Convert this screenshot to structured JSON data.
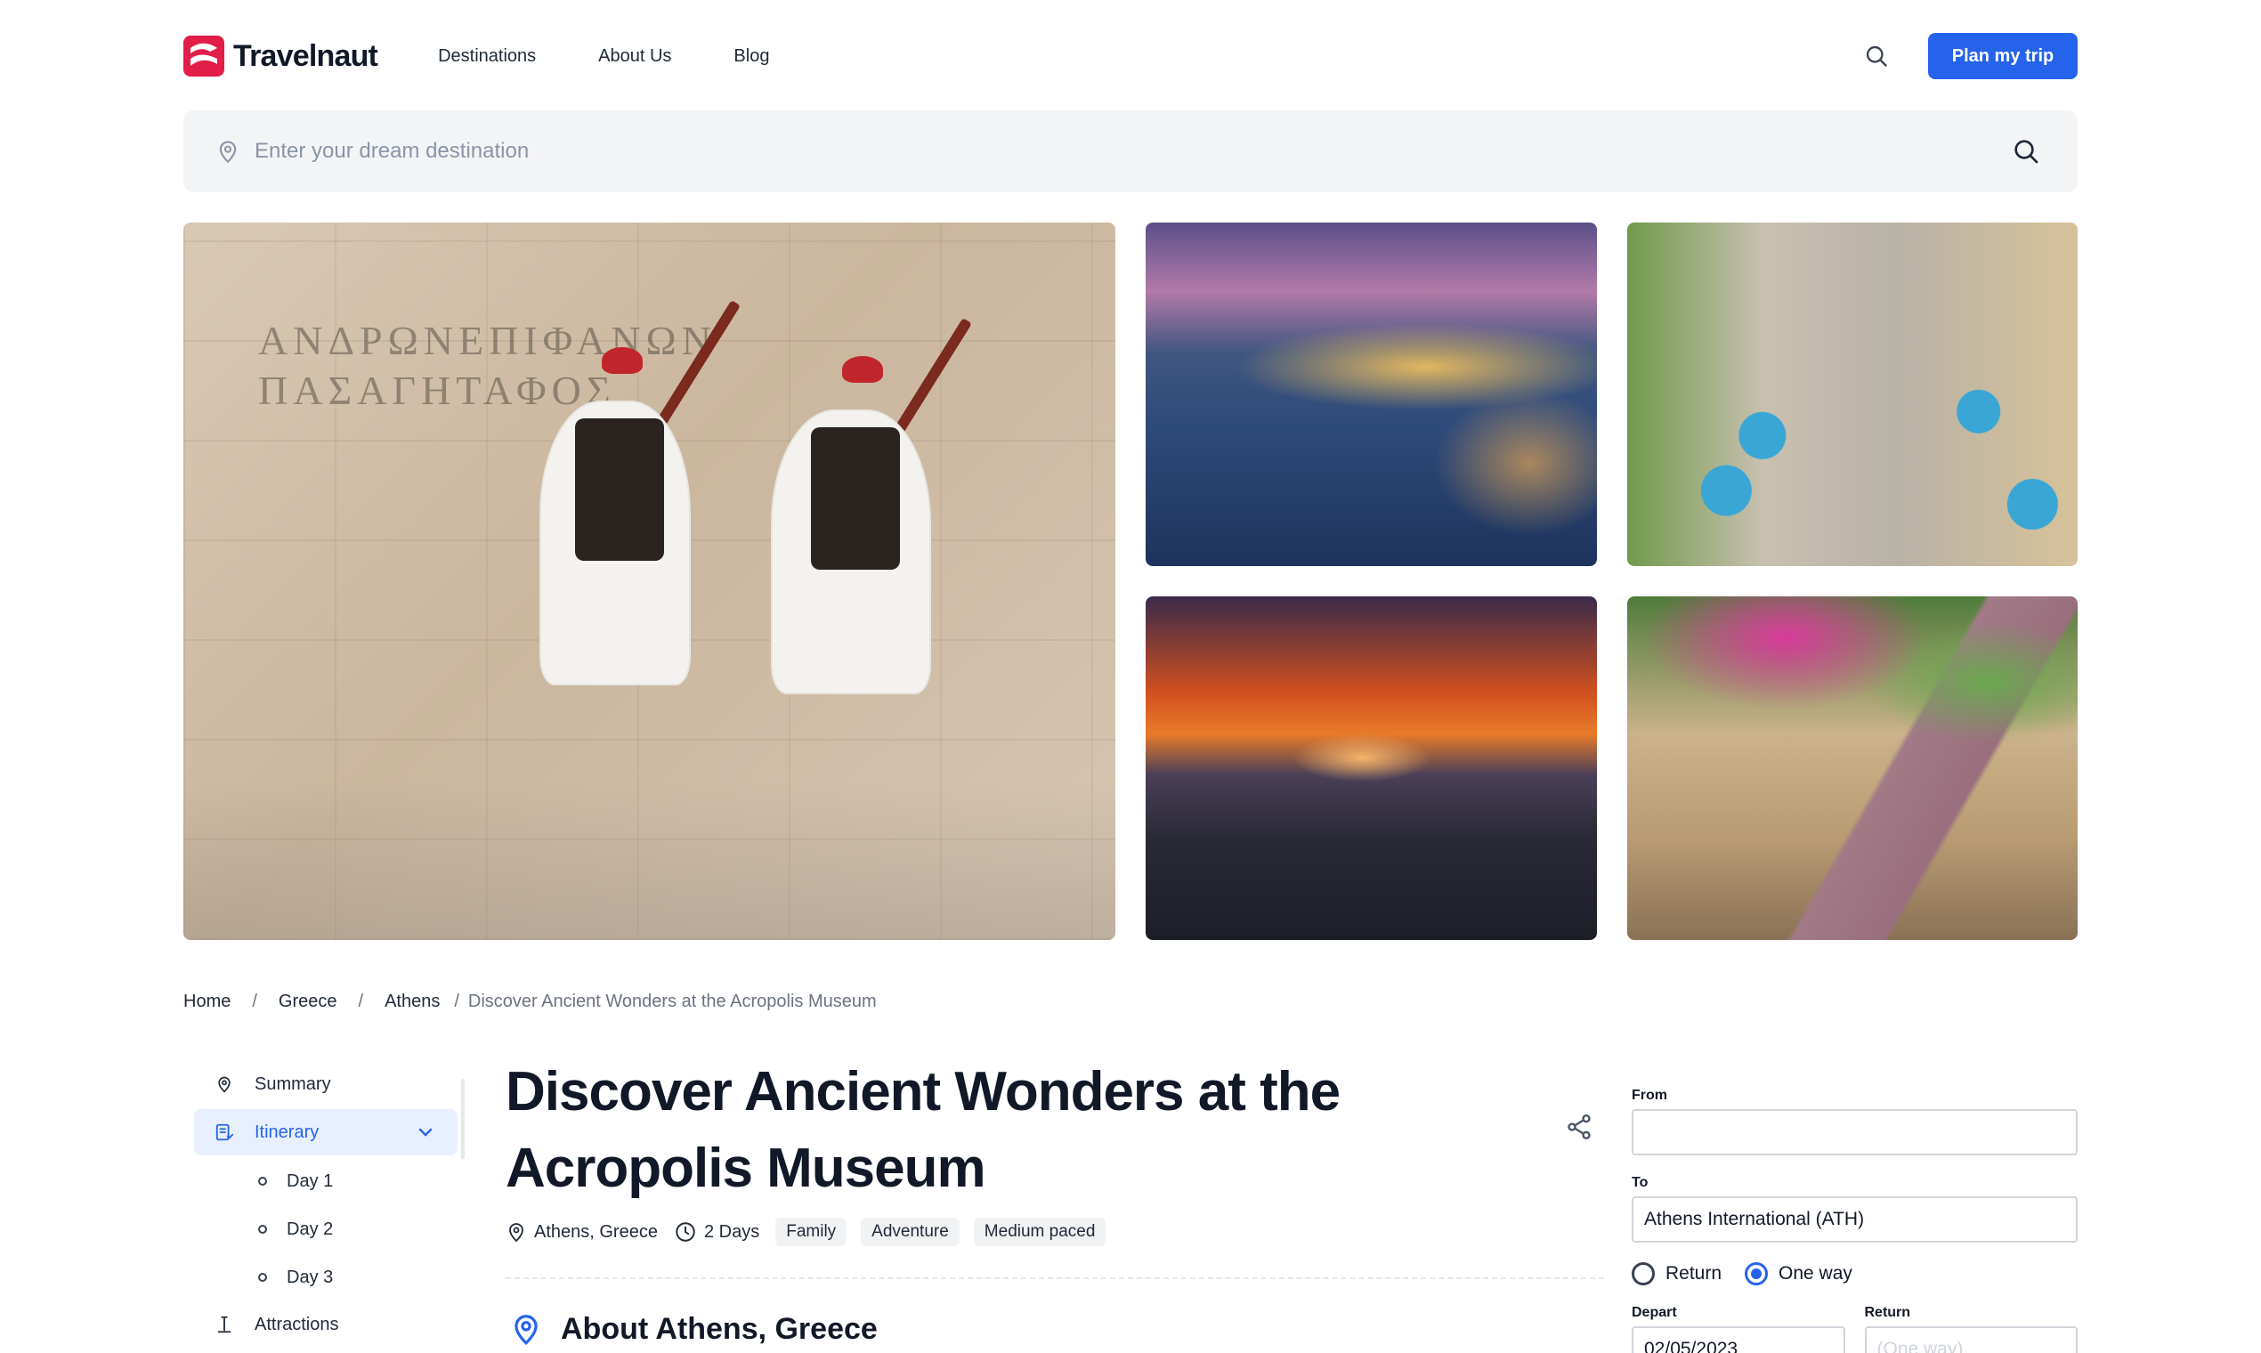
{
  "brand": {
    "name": "Travelnaut",
    "accent": "#2563eb",
    "logo_color": "#e11d48"
  },
  "nav": {
    "links": [
      "Destinations",
      "About Us",
      "Blog"
    ]
  },
  "header": {
    "search_icon": "search-icon",
    "cta_label": "Plan my trip"
  },
  "search": {
    "placeholder": "Enter your dream destination",
    "value": ""
  },
  "gallery": {
    "photos": [
      {
        "name": "evzones-guards-photo"
      },
      {
        "name": "harbor-at-dusk-photo"
      },
      {
        "name": "cafe-tables-photo"
      },
      {
        "name": "acropolis-sunset-photo"
      },
      {
        "name": "flowered-street-photo"
      }
    ],
    "inscription": [
      "ΑΝΔΡΩΝΕΠΙΦΑΝΩΝ",
      "ΠΑΣΑΓΗΤΑΦΟΣ"
    ]
  },
  "breadcrumb": {
    "items": [
      "Home",
      "Greece",
      "Athens"
    ],
    "current": "Discover Ancient Wonders at the Acropolis Museum",
    "separator": "/"
  },
  "sidenav": {
    "summary": "Summary",
    "itinerary": "Itinerary",
    "days": [
      "Day 1",
      "Day 2",
      "Day 3"
    ],
    "attractions": "Attractions"
  },
  "article": {
    "title": "Discover Ancient Wonders at the Acropolis Museum",
    "location": "Athens, Greece",
    "duration": "2 Days",
    "tags": [
      "Family",
      "Adventure",
      "Medium paced"
    ],
    "about_heading": "About Athens, Greece"
  },
  "booking": {
    "from_label": "From",
    "from_value": "",
    "to_label": "To",
    "to_value": "Athens International (ATH)",
    "trip_types": [
      "Return",
      "One way"
    ],
    "selected_trip_type": "One way",
    "depart_label": "Depart",
    "depart_value": "02/05/2023",
    "return_label": "Return",
    "return_placeholder": "(One way)"
  }
}
